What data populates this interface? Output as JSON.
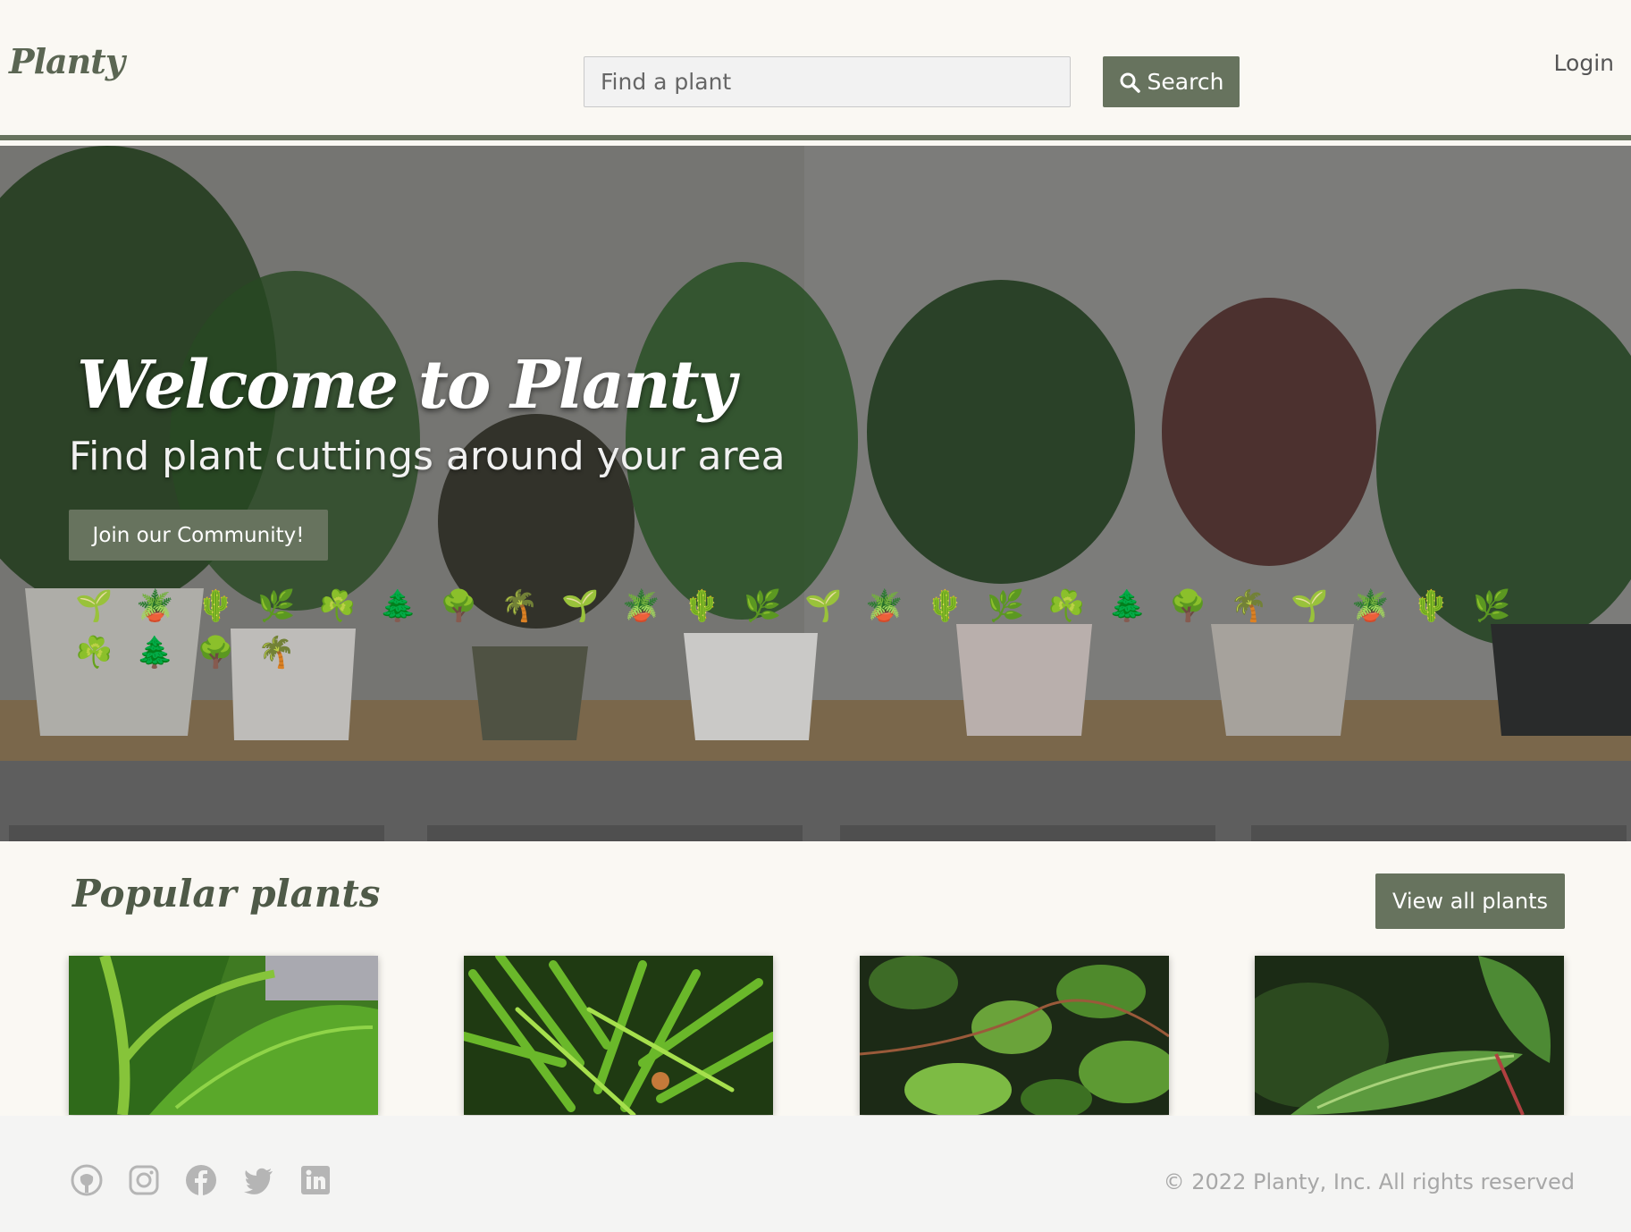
{
  "header": {
    "logo": "Planty",
    "search_placeholder": "Find a plant",
    "search_label": "Search",
    "login_label": "Login"
  },
  "hero": {
    "title": "Welcome to Planty",
    "subtitle": "Find plant cuttings around your area",
    "cta_label": "Join our Community!",
    "emojis": [
      "🌱",
      "🪴",
      "🌵",
      "🌿",
      "☘️",
      "🌲",
      "🌳",
      "🌴",
      "🌱",
      "🪴",
      "🌵",
      "🌿",
      "🌱",
      "🪴",
      "🌵",
      "🌿",
      "☘️",
      "🌲",
      "🌳",
      "🌴",
      "🌱",
      "🪴",
      "🌵",
      "🌿",
      "☘️",
      "🌲",
      "🌳",
      "🌴"
    ]
  },
  "popular": {
    "title": "Popular plants",
    "view_all_label": "View all plants",
    "cards": [
      {
        "name": "plant-card-1"
      },
      {
        "name": "plant-card-2"
      },
      {
        "name": "plant-card-3"
      },
      {
        "name": "plant-card-4"
      }
    ]
  },
  "footer": {
    "social_icons": [
      "github-icon",
      "instagram-icon",
      "facebook-icon",
      "twitter-icon",
      "linkedin-icon"
    ],
    "copyright": "© 2022 Planty, Inc. All rights reserved"
  },
  "colors": {
    "brand": "#67735e",
    "page_bg": "#faf8f3",
    "footer_bg": "#f4f4f3"
  }
}
